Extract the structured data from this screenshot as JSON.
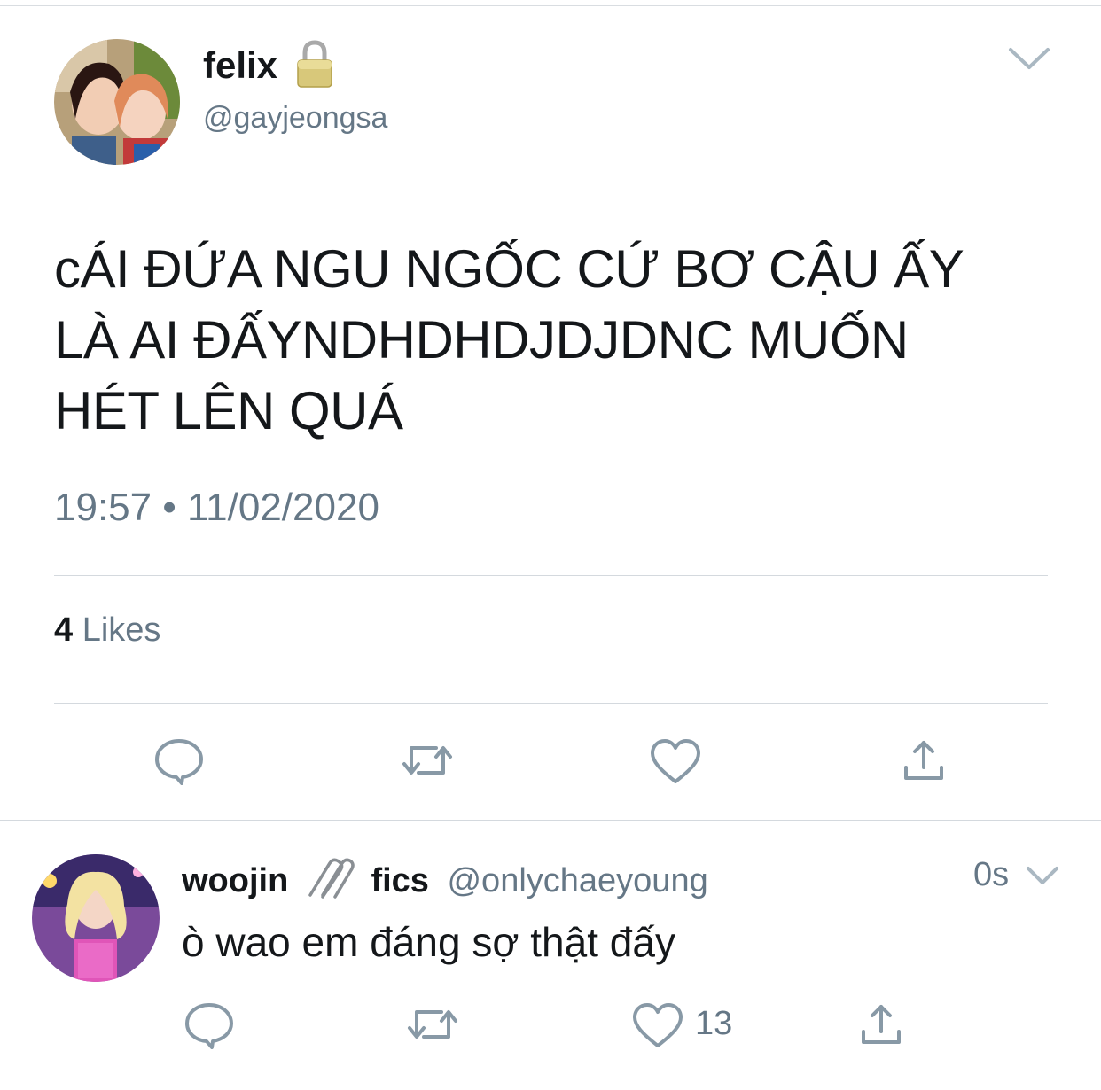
{
  "tweet": {
    "display_name": "felix",
    "handle": "@gayjeongsa",
    "text_lines": [
      "cÁI ĐỨA NGU NGỐC CỨ BƠ CẬU ẤY",
      "LÀ AI ĐẤYNDHDHDJDJDNC MUỐN",
      "HÉT LÊN QUÁ"
    ],
    "timestamp": "19:57 • 11/02/2020",
    "likes_count": "4",
    "likes_label": "Likes"
  },
  "reply": {
    "display_name_part1": "woojin",
    "display_name_part2": "fics",
    "handle": "@onlychaeyoung",
    "time": "0s",
    "text": "ò wao em đáng sợ thật đấy",
    "like_count": "13"
  },
  "icons": {
    "lock": "lock-icon",
    "caret": "chevron-down-icon",
    "reply": "reply-icon",
    "retweet": "retweet-icon",
    "like": "heart-icon",
    "share": "share-icon",
    "paperclip": "paperclip-icon"
  },
  "colors": {
    "text": "#14171a",
    "secondary": "#657786",
    "divider": "#d4d9de"
  }
}
